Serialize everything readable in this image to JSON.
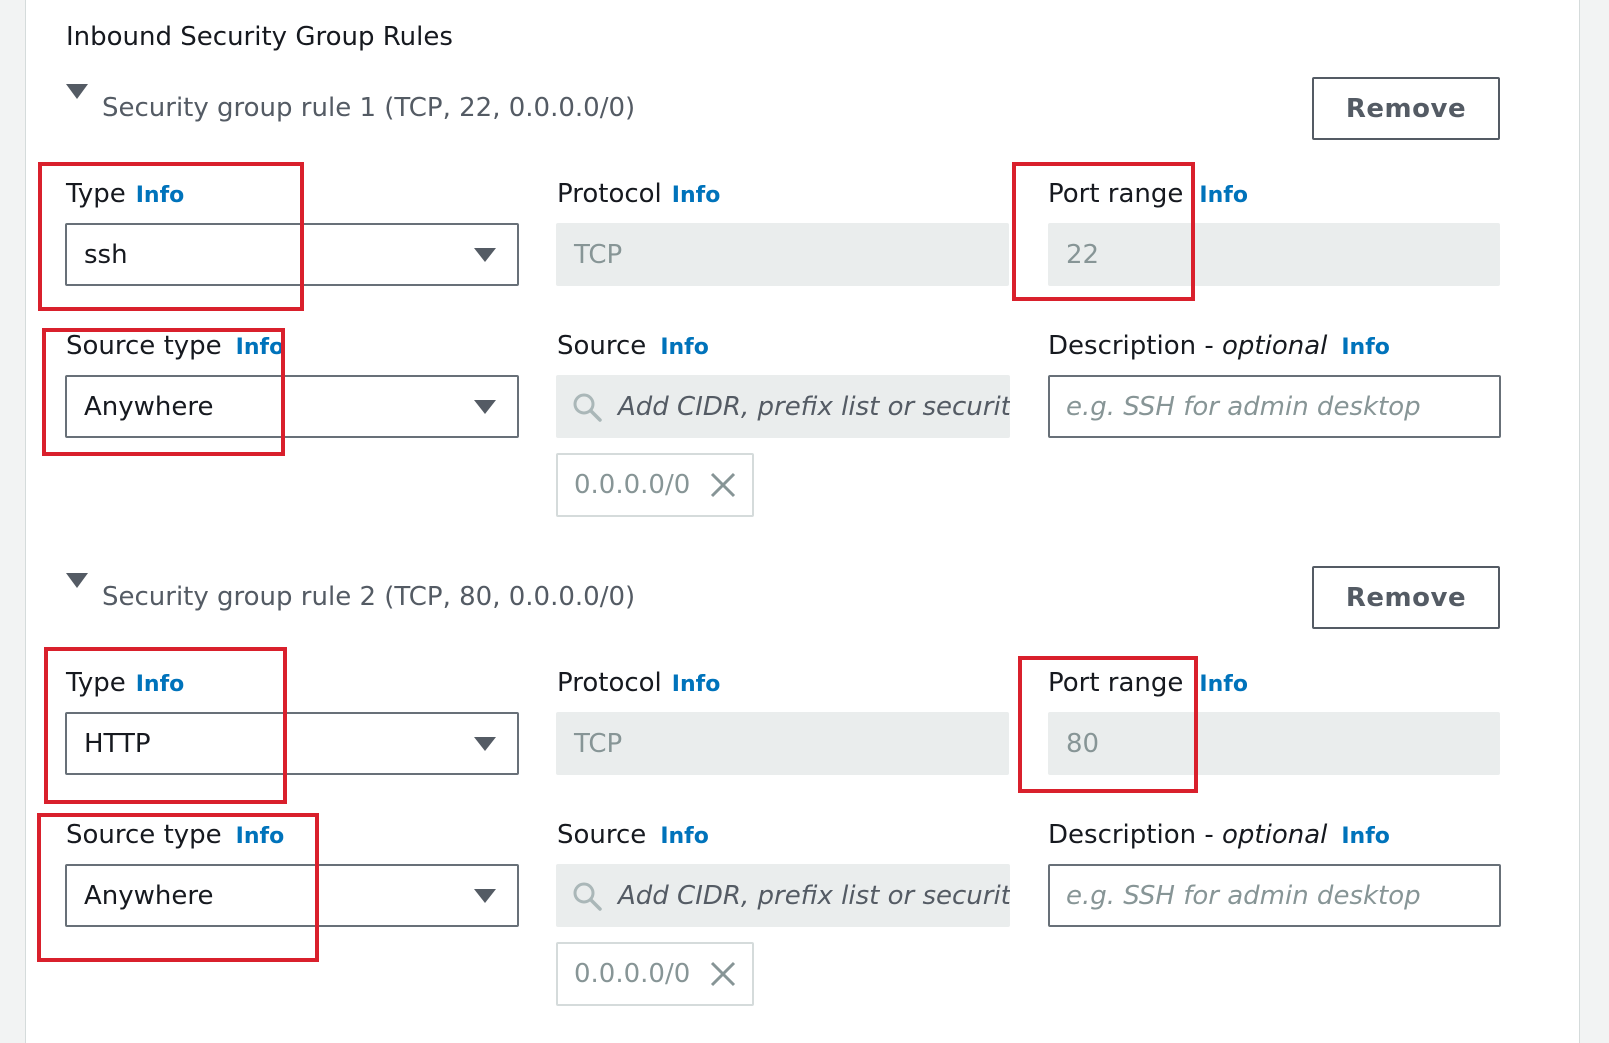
{
  "section_title": "Inbound Security Group Rules",
  "info_link": "Info",
  "remove_label": "Remove",
  "labels": {
    "type": "Type",
    "protocol": "Protocol",
    "port_range": "Port range",
    "source_type": "Source type",
    "source": "Source",
    "description": "Description - ",
    "optional": "optional"
  },
  "rules": [
    {
      "title": "Security group rule 1 (TCP, 22, 0.0.0.0/0)",
      "type_value": "ssh",
      "protocol_value": "TCP",
      "port_value": "22",
      "source_type_value": "Anywhere",
      "source_placeholder": "Add CIDR, prefix list or security",
      "description_placeholder": "e.g. SSH for admin desktop",
      "source_token": "0.0.0.0/0"
    },
    {
      "title": "Security group rule 2 (TCP, 80, 0.0.0.0/0)",
      "type_value": "HTTP",
      "protocol_value": "TCP",
      "port_value": "80",
      "source_type_value": "Anywhere",
      "source_placeholder": "Add CIDR, prefix list or security",
      "description_placeholder": "e.g. SSH for admin desktop",
      "source_token": "0.0.0.0/0"
    }
  ],
  "icons": {
    "caret": "caret-down-icon",
    "dropdown": "triangle-down-icon",
    "search": "search-icon",
    "remove_token": "close-icon"
  },
  "colors": {
    "info_link": "#0073bb",
    "highlight": "#d9202c",
    "disabled_bg": "#eaeded"
  }
}
